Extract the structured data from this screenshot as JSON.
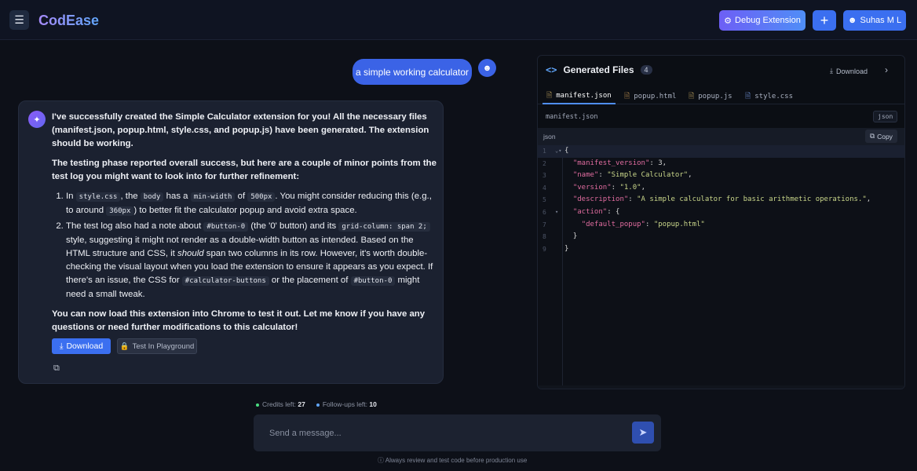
{
  "app": {
    "brand": "CodEase",
    "debug_label": "Debug Extension",
    "plus_label": "+",
    "user_label": "Suhas M L"
  },
  "chat": {
    "user_message": "a simple working calculator",
    "ai": {
      "para1": "I've successfully created the Simple Calculator extension for you! All the necessary files (manifest.json, popup.html, style.css, and popup.js) have been generated. The extension should be working.",
      "para2": "The testing phase reported overall success, but here are a couple of minor points from the test log you might want to look into for further refinement:",
      "item1": {
        "t1": "In ",
        "c1": "style.css",
        "t2": ", the ",
        "c2": "body",
        "t3": " has a ",
        "c3": "min-width",
        "t4": " of ",
        "c4": "500px",
        "t5": ". You might consider reducing this (e.g., to around ",
        "c5": "360px",
        "t6": ") to better fit the calculator popup and avoid extra space."
      },
      "item2": {
        "t1": "The test log also had a note about ",
        "c1": "#button-0",
        "t2": " (the '0' button) and its ",
        "c2": "grid-column: span 2;",
        "t3": " style, suggesting it might not render as a double-width button as intended. Based on the HTML structure and CSS, it ",
        "em": "should",
        "t4": " span two columns in its row. However, it's worth double-checking the visual layout when you load the extension to ensure it appears as you expect. If there's an issue, the CSS for ",
        "c3": "#calculator-buttons",
        "t5": " or the placement of ",
        "c4": "#button-0",
        "t6": " might need a small tweak."
      },
      "para3": "You can now load this extension into Chrome to test it out. Let me know if you have any questions or need further modifications to this calculator!",
      "download_label": "Download",
      "playground_label": "Test In Playground"
    }
  },
  "footer": {
    "credits_label": "Credits left:",
    "credits_value": "27",
    "followups_label": "Follow-ups left:",
    "followups_value": "10",
    "input_placeholder": "Send a message...",
    "disclaimer": "Always review and test code before production use"
  },
  "panel": {
    "title": "Generated Files",
    "count": "4",
    "download_label": "Download",
    "tabs": [
      {
        "label": "manifest.json",
        "icon": "json-file-icon"
      },
      {
        "label": "popup.html",
        "icon": "html-file-icon"
      },
      {
        "label": "popup.js",
        "icon": "js-file-icon"
      },
      {
        "label": "style.css",
        "icon": "css-file-icon"
      }
    ],
    "path": "manifest.json",
    "lang_pill": "json",
    "toolbar_lang": "json",
    "copy_label": "Copy",
    "code_lines": [
      "{",
      "  \"manifest_version\": 3,",
      "  \"name\": \"Simple Calculator\",",
      "  \"version\": \"1.0\",",
      "  \"description\": \"A simple calculator for basic arithmetic operations.\",",
      "  \"action\": {",
      "    \"default_popup\": \"popup.html\"",
      "  }",
      "}"
    ],
    "line_numbers": [
      "1",
      "2",
      "3",
      "4",
      "5",
      "6",
      "7",
      "8",
      "9"
    ]
  },
  "colors": {
    "accent": "#3b6ff0",
    "brand_gradient_start": "#a78bfa",
    "brand_gradient_end": "#60a5fa",
    "key_color": "#e06c9f",
    "string_color": "#c9d68a"
  }
}
